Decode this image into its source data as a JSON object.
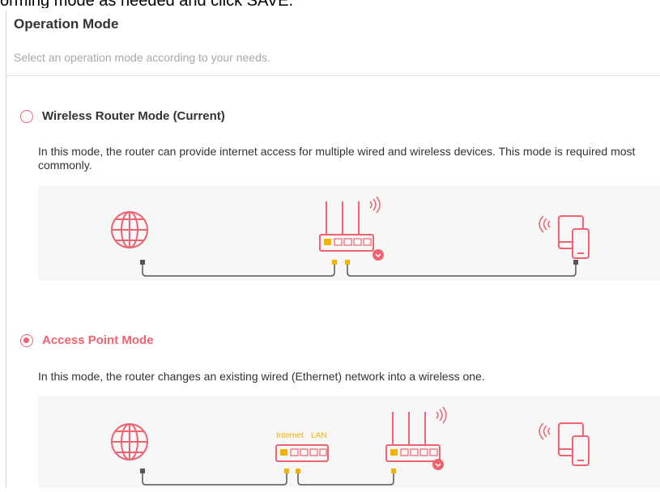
{
  "page": {
    "top_cut_text": "orming mode as needed and click SAVE.",
    "title": "Operation Mode",
    "subtitle": "Select an operation mode according to your needs."
  },
  "options": [
    {
      "label": "Wireless Router Mode (Current)",
      "selected": false,
      "description": "In this mode, the router can provide internet access for multiple wired and wireless devices. This mode is required most commonly."
    },
    {
      "label": "Access Point Mode",
      "selected": true,
      "description": "In this mode, the router changes an existing wired (Ethernet) network into a wireless one."
    }
  ],
  "diagram_labels": {
    "internet": "Internet",
    "lan": "LAN"
  },
  "colors": {
    "accent": "#f0626f",
    "port": "#f5b100",
    "cable": "#555555"
  }
}
